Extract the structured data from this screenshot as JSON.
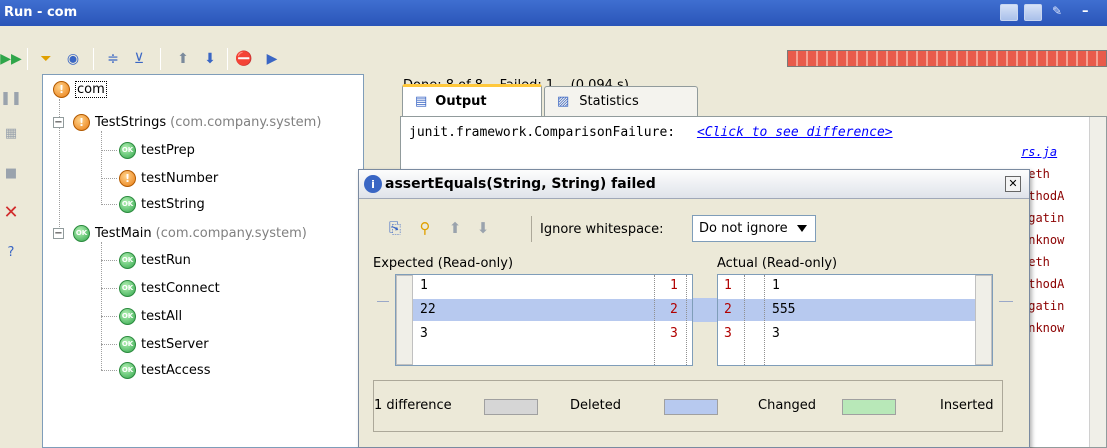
{
  "window": {
    "title": "Run - com"
  },
  "toolbar": {
    "status_done": "Done: 8 of 8",
    "status_failed": "Failed: 1",
    "status_time": "(0,094 s)"
  },
  "tree": {
    "root": "com",
    "suites": [
      {
        "name": "TestStrings",
        "package": "(com.company.system)",
        "tests": [
          {
            "name": "testPrep"
          },
          {
            "name": "testNumber"
          },
          {
            "name": "testString"
          }
        ]
      },
      {
        "name": "TestMain",
        "package": "(com.company.system)",
        "tests": [
          {
            "name": "testRun"
          },
          {
            "name": "testConnect"
          },
          {
            "name": "testAll"
          },
          {
            "name": "testServer"
          },
          {
            "name": "testAccess"
          }
        ]
      }
    ]
  },
  "tabs": {
    "output": "Output",
    "statistics": "Statistics"
  },
  "console": {
    "failure": "junit.framework.ComparisonFailure:",
    "link": "<Click to see difference>",
    "stack": [
      "rs.ja",
      "Meth",
      "ethodA",
      "egatin",
      "Unknow",
      "Meth",
      "ethodA",
      "egatin",
      "Unknow"
    ]
  },
  "dialog": {
    "title": "assertEquals(String, String) failed",
    "ignore_label": "Ignore whitespace:",
    "ignore_value": "Do not ignore",
    "expected_label": "Expected (Read-only)",
    "actual_label": "Actual (Read-only)",
    "expected_lines": [
      "1",
      "22",
      "3"
    ],
    "actual_lines": [
      "1",
      "555",
      "3"
    ],
    "line_numbers": [
      "1",
      "2",
      "3"
    ],
    "legend": {
      "summary": "1 difference",
      "deleted": "Deleted",
      "changed": "Changed",
      "inserted": "Inserted"
    }
  },
  "colors": {
    "changed": "#b7c9ef",
    "deleted": "#d6d6d6",
    "inserted": "#b8e8b8",
    "progress": "#e85b4b"
  }
}
